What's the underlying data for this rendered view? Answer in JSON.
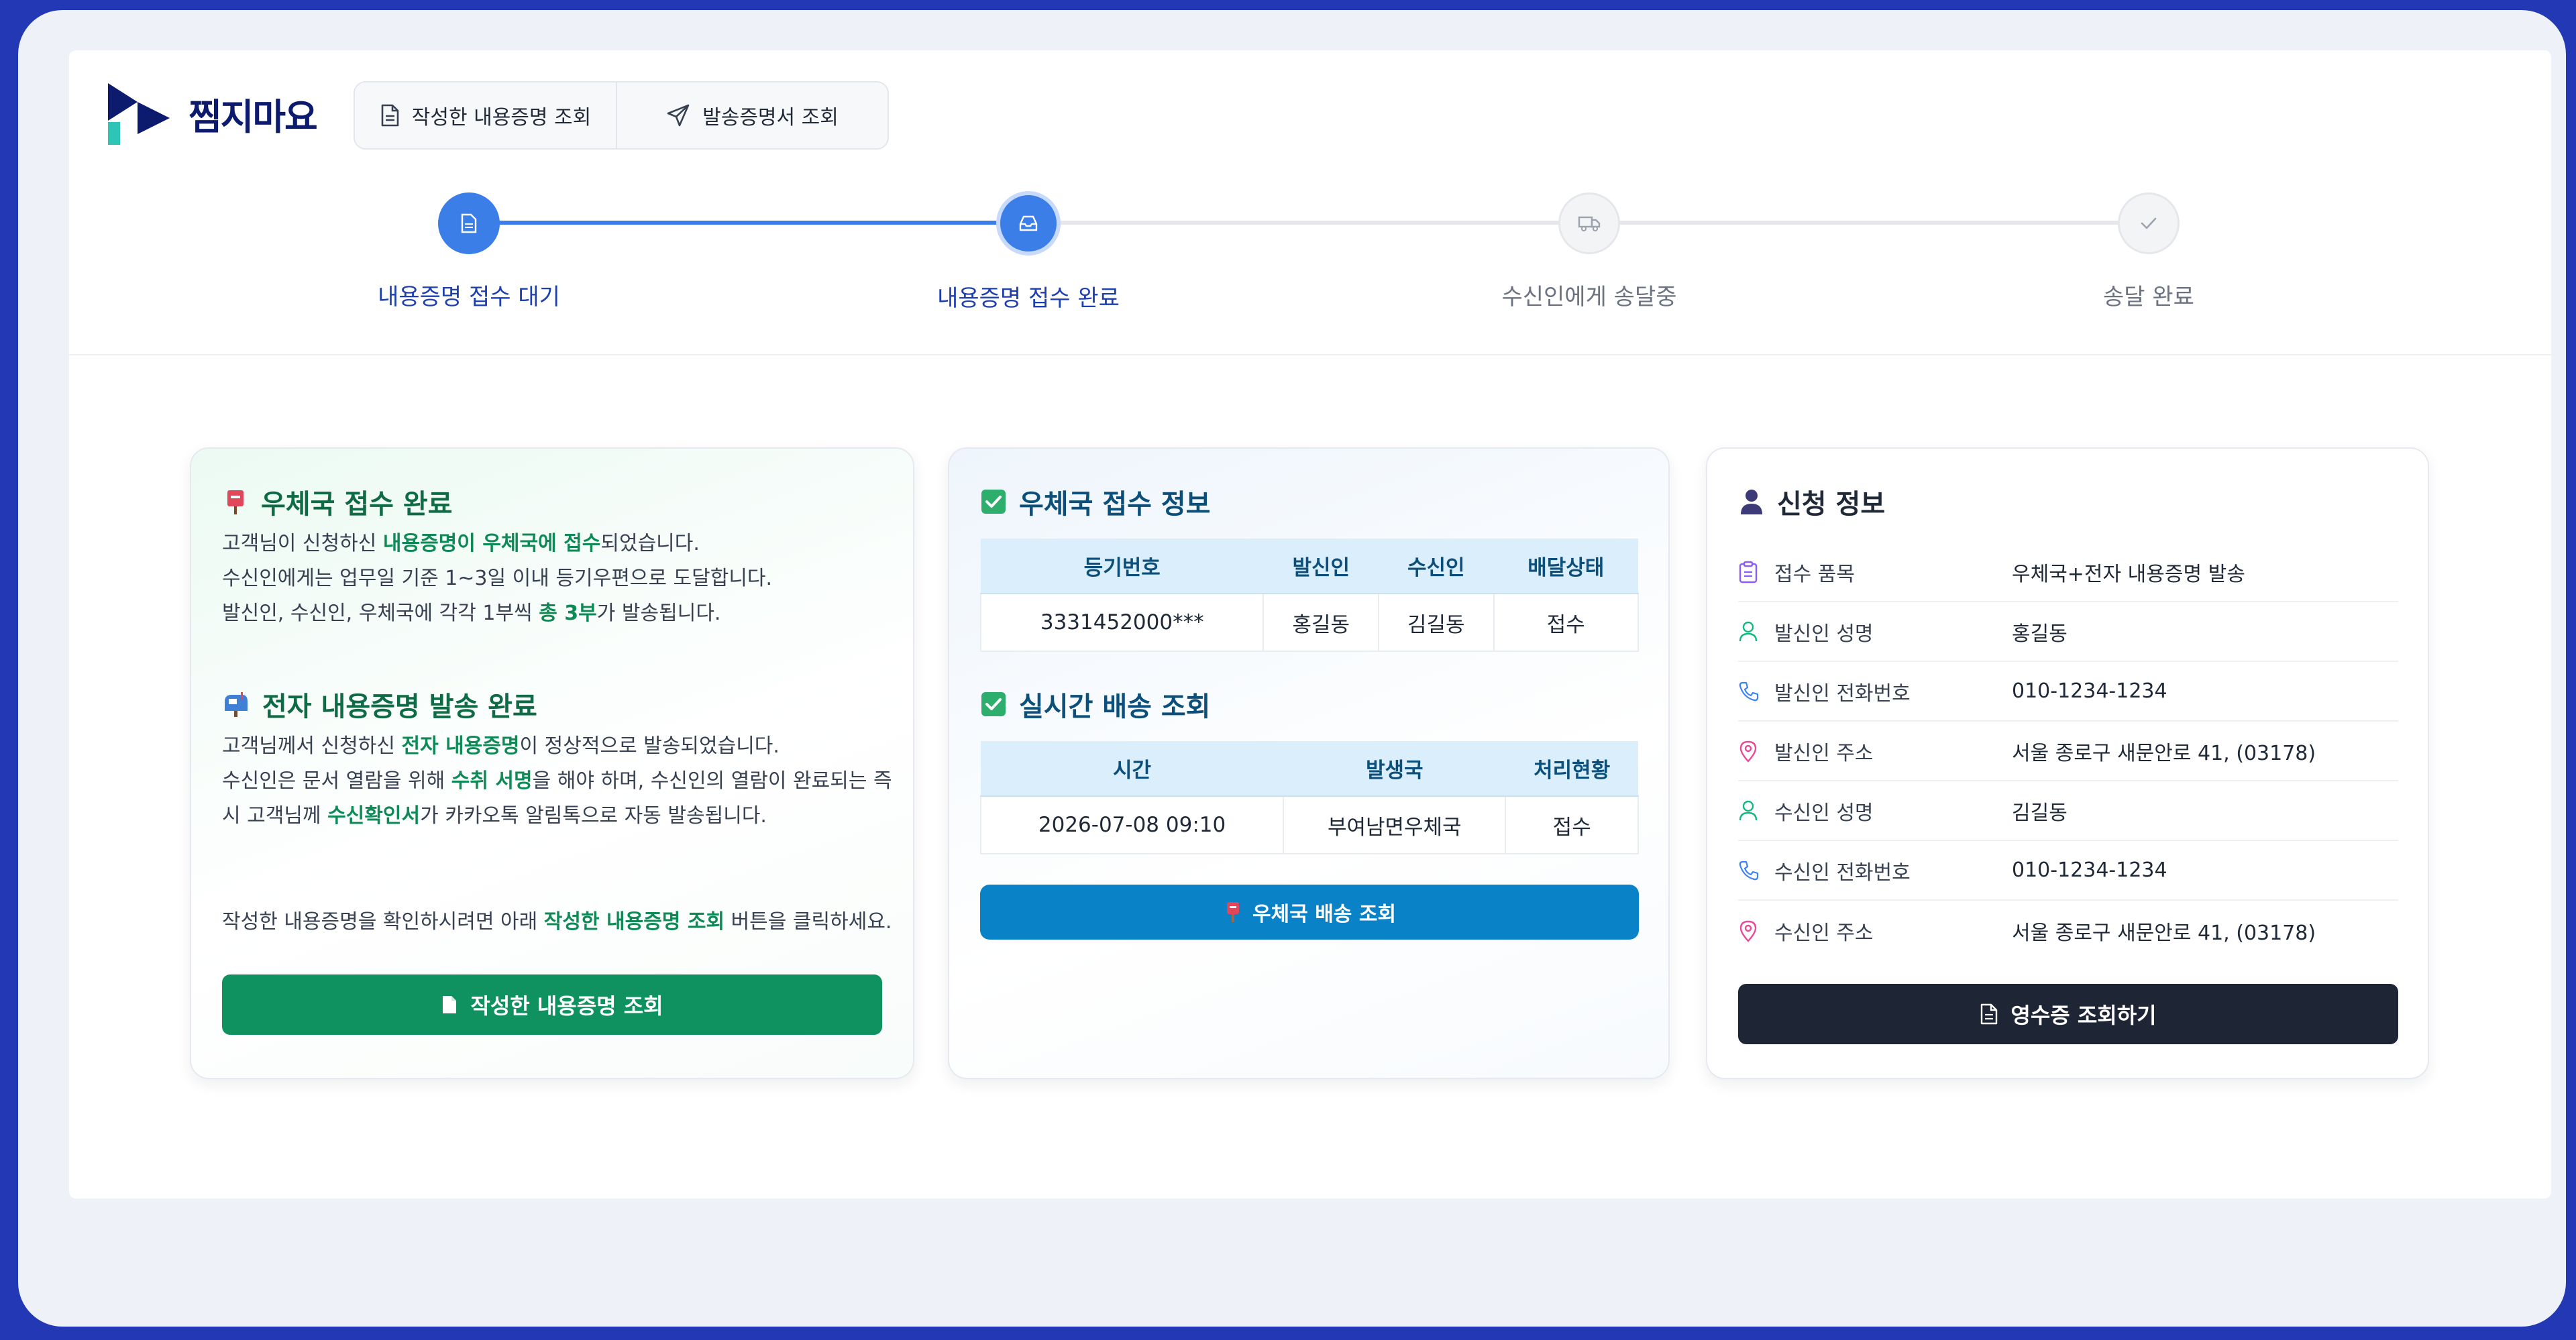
{
  "app": {
    "logo_text": "찜지마요"
  },
  "nav": {
    "written_label": "작성한 내용증명 조회",
    "dispatch_label": "발송증명서 조회"
  },
  "steps": [
    {
      "label": "내용증명 접수 대기",
      "state": "done"
    },
    {
      "label": "내용증명 접수 완료",
      "state": "current"
    },
    {
      "label": "수신인에게 송달중",
      "state": "pending"
    },
    {
      "label": "송달 완료",
      "state": "pending"
    }
  ],
  "panel1": {
    "title1": "우체국 접수 완료",
    "p1_l1_a": "고객님이 신청하신 ",
    "p1_l1_b": "내용증명이 우체국에 접수",
    "p1_l1_c": "되었습니다.",
    "p1_l2": "수신인에게는 업무일 기준 1~3일 이내 등기우편으로 도달합니다.",
    "p1_l3_a": "발신인, 수신인, 우체국에 각각 1부씩 ",
    "p1_l3_b": "총 3부",
    "p1_l3_c": "가 발송됩니다.",
    "title2": "전자 내용증명 발송 완료",
    "p2_l1_a": "고객님께서 신청하신 ",
    "p2_l1_b": "전자 내용증명",
    "p2_l1_c": "이 정상적으로 발송되었습니다.",
    "p2_l2_a": "수신인은 문서 열람을 위해 ",
    "p2_l2_b": "수취 서명",
    "p2_l2_c": "을 해야 하며, 수신인의 열람이 완료되는 즉",
    "p2_l3_a": "시 고객님께 ",
    "p2_l3_b": "수신확인서",
    "p2_l3_c": "가 카카오톡 알림톡으로 자동 발송됩니다.",
    "p3_a": "작성한 내용증명을 확인하시려면 아래 ",
    "p3_b": "작성한 내용증명 조회",
    "p3_c": " 버튼을 클릭하세요.",
    "button": "작성한 내용증명 조회"
  },
  "panel2": {
    "title1": "우체국 접수 정보",
    "reg_headers": [
      "등기번호",
      "발신인",
      "수신인",
      "배달상태"
    ],
    "reg_row": [
      "3331452000***",
      "홍길동",
      "김길동",
      "접수"
    ],
    "title2": "실시간 배송 조회",
    "track_headers": [
      "시간",
      "발생국",
      "처리현황"
    ],
    "track_row": [
      "2026-07-08 09:10",
      "부여남면우체국",
      "접수"
    ],
    "button": "우체국 배송 조회"
  },
  "panel3": {
    "title": "신청 정보",
    "rows": [
      {
        "icon": "clipboard-icon",
        "key": "접수 품목",
        "value": "우체국+전자 내용증명 발송"
      },
      {
        "icon": "user-icon",
        "key": "발신인 성명",
        "value": "홍길동"
      },
      {
        "icon": "phone-icon",
        "key": "발신인 전화번호",
        "value": "010-1234-1234"
      },
      {
        "icon": "location-pin-icon",
        "key": "발신인 주소",
        "value": "서울 종로구 새문안로 41, (03178)"
      },
      {
        "icon": "user-icon",
        "key": "수신인 성명",
        "value": "김길동"
      },
      {
        "icon": "phone-icon",
        "key": "수신인 전화번호",
        "value": "010-1234-1234"
      },
      {
        "icon": "location-pin-icon",
        "key": "수신인 주소",
        "value": "서울 종로구 새문안로 41, (03178)"
      }
    ],
    "button": "영수증 조회하기"
  },
  "colors": {
    "brand_blue": "#3b7ee8",
    "green": "#0f9260",
    "post_blue": "#0a82c7",
    "dark": "#1e2535"
  }
}
